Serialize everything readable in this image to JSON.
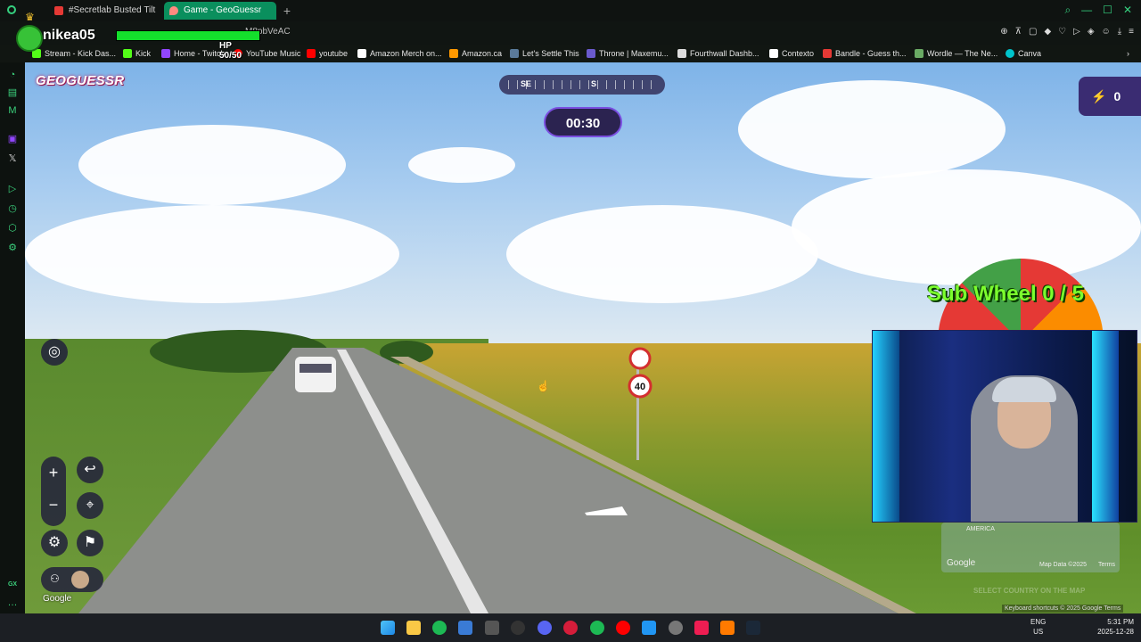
{
  "browser": {
    "tabs": [
      {
        "label": "#Secretlab Busted Tilt - Re",
        "active": false,
        "color": "#e53935"
      },
      {
        "label": "Game - GeoGuessr",
        "active": true,
        "color": "#ff5252"
      }
    ],
    "new_tab_label": "+",
    "url": "M8pbVeAC",
    "bookmarks": [
      {
        "label": "Stream - Kick Das...",
        "color": "#53fc18"
      },
      {
        "label": "Kick",
        "color": "#53fc18"
      },
      {
        "label": "Home - Twitch",
        "color": "#9146ff"
      },
      {
        "label": "YouTube Music",
        "color": "#ff0000"
      },
      {
        "label": "youtube",
        "color": "#ff0000"
      },
      {
        "label": "Amazon Merch on...",
        "color": "#ffffff"
      },
      {
        "label": "Amazon.ca",
        "color": "#ff9900"
      },
      {
        "label": "Let's Settle This",
        "color": "#5a7a9a"
      },
      {
        "label": "Throne | Maxemu...",
        "color": "#6a5acd"
      },
      {
        "label": "Fourthwall Dashb...",
        "color": "#dddddd"
      },
      {
        "label": "Contexto",
        "color": "#ffffff"
      },
      {
        "label": "Bandle - Guess th...",
        "color": "#e53935"
      },
      {
        "label": "Wordle — The Ne...",
        "color": "#6aaa64"
      },
      {
        "label": "Canva",
        "color": "#00c4cc"
      }
    ]
  },
  "stream_overlay": {
    "username": "nikea05",
    "hp_text": "HP 50/50",
    "hp_fraction": 1.0
  },
  "game": {
    "logo": "GEOGUESSR",
    "compass": {
      "left": "SE",
      "center": "S"
    },
    "timer": "00:30",
    "energy": "0",
    "road_sign": "40",
    "google_watermark": "Google",
    "select_country": "SELECT COUNTRY ON THE MAP",
    "map_labels": {
      "region": "AMERICA",
      "google": "Google",
      "data": "Map Data ©2025",
      "terms": "Terms"
    },
    "attribution": "Keyboard shortcuts   © 2025 Google   Terms"
  },
  "sub_wheel": {
    "label": "Sub Wheel 0 / 5"
  },
  "taskbar": {
    "lang_top": "ENG",
    "lang_bottom": "US",
    "time": "5:31 PM",
    "date": "2025-12-28"
  },
  "colors": {
    "accent_green": "#0a8f5d",
    "hp_green": "#14e02c",
    "game_purple": "#2b2350"
  }
}
